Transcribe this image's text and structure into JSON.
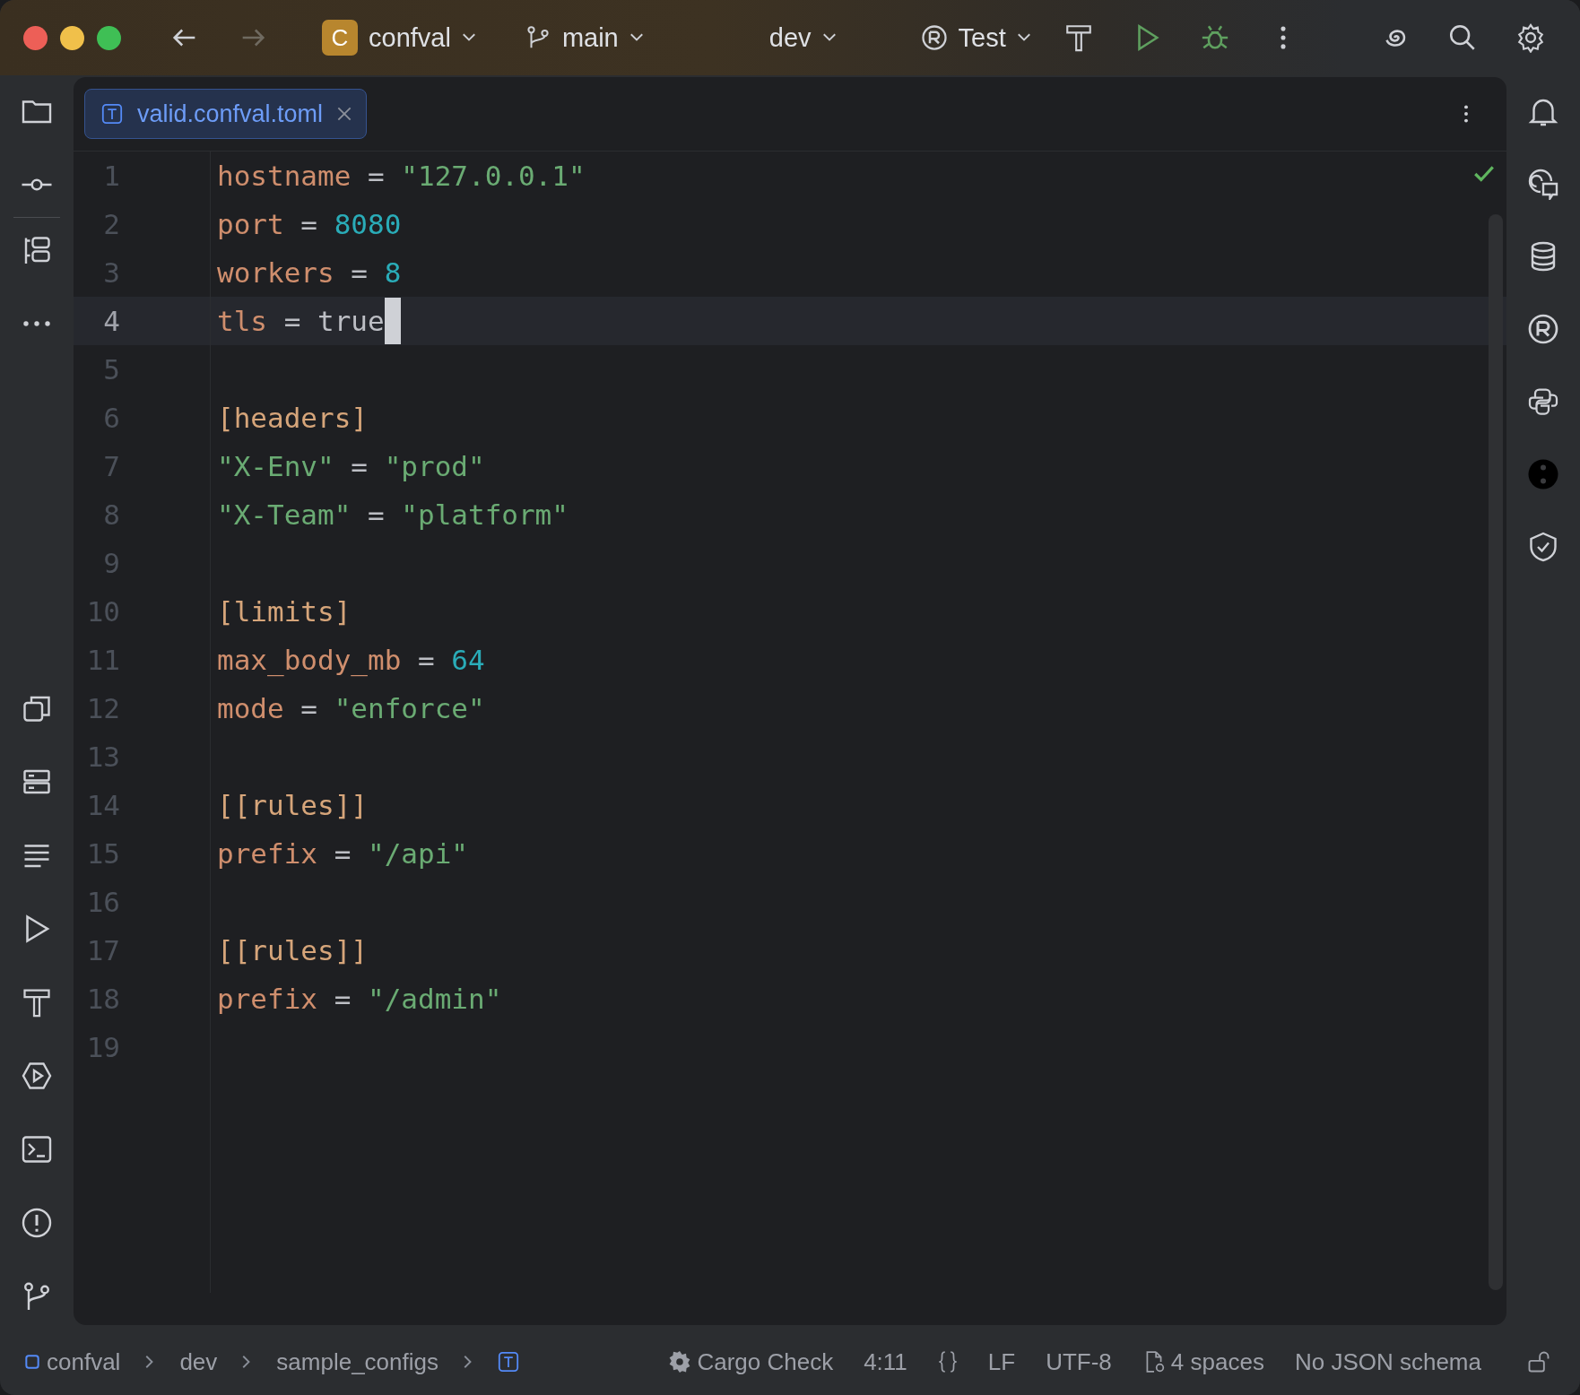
{
  "toolbar": {
    "project_badge": "C",
    "project": "confval",
    "branch": "main",
    "profile": "dev",
    "run_config": "Test"
  },
  "tabs": [
    {
      "label": "valid.confval.toml",
      "selected": true
    }
  ],
  "editor": {
    "lines": [
      {
        "number": "1",
        "current": false,
        "tokens": [
          {
            "kind": "key",
            "text": "hostname"
          },
          {
            "kind": "op",
            "text": " = "
          },
          {
            "kind": "string",
            "text": "\"127.0.0.1\""
          }
        ]
      },
      {
        "number": "2",
        "current": false,
        "tokens": [
          {
            "kind": "key",
            "text": "port"
          },
          {
            "kind": "op",
            "text": " = "
          },
          {
            "kind": "number",
            "text": "8080"
          }
        ]
      },
      {
        "number": "3",
        "current": false,
        "tokens": [
          {
            "kind": "key",
            "text": "workers"
          },
          {
            "kind": "op",
            "text": " = "
          },
          {
            "kind": "number",
            "text": "8"
          }
        ]
      },
      {
        "number": "4",
        "current": true,
        "tokens": [
          {
            "kind": "key",
            "text": "tls"
          },
          {
            "kind": "op",
            "text": " = "
          },
          {
            "kind": "bool",
            "text": "true"
          }
        ]
      },
      {
        "number": "5",
        "current": false
      },
      {
        "number": "6",
        "current": false,
        "tokens": [
          {
            "kind": "section",
            "text": "[headers]"
          }
        ]
      },
      {
        "number": "7",
        "current": false,
        "tokens": [
          {
            "kind": "string",
            "text": "\"X-Env\""
          },
          {
            "kind": "op",
            "text": " = "
          },
          {
            "kind": "string",
            "text": "\"prod\""
          }
        ]
      },
      {
        "number": "8",
        "current": false,
        "tokens": [
          {
            "kind": "string",
            "text": "\"X-Team\""
          },
          {
            "kind": "op",
            "text": " = "
          },
          {
            "kind": "string",
            "text": "\"platform\""
          }
        ]
      },
      {
        "number": "9",
        "current": false
      },
      {
        "number": "10",
        "current": false,
        "tokens": [
          {
            "kind": "section",
            "text": "[limits]"
          }
        ]
      },
      {
        "number": "11",
        "current": false,
        "tokens": [
          {
            "kind": "key",
            "text": "max_body_mb"
          },
          {
            "kind": "op",
            "text": " = "
          },
          {
            "kind": "number",
            "text": "64"
          }
        ]
      },
      {
        "number": "12",
        "current": false,
        "tokens": [
          {
            "kind": "key",
            "text": "mode"
          },
          {
            "kind": "op",
            "text": " = "
          },
          {
            "kind": "string",
            "text": "\"enforce\""
          }
        ]
      },
      {
        "number": "13",
        "current": false
      },
      {
        "number": "14",
        "current": false,
        "tokens": [
          {
            "kind": "section",
            "text": "[[rules]]"
          }
        ]
      },
      {
        "number": "15",
        "current": false,
        "tokens": [
          {
            "kind": "key",
            "text": "prefix"
          },
          {
            "kind": "op",
            "text": " = "
          },
          {
            "kind": "string",
            "text": "\"/api\""
          }
        ]
      },
      {
        "number": "16",
        "current": false
      },
      {
        "number": "17",
        "current": false,
        "tokens": [
          {
            "kind": "section",
            "text": "[[rules]]"
          }
        ]
      },
      {
        "number": "18",
        "current": false,
        "tokens": [
          {
            "kind": "key",
            "text": "prefix"
          },
          {
            "kind": "op",
            "text": " = "
          },
          {
            "kind": "string",
            "text": "\"/admin\""
          }
        ]
      },
      {
        "number": "19",
        "current": false
      }
    ]
  },
  "status_bar": {
    "breadcrumbs": [
      "confval",
      "dev",
      "sample_configs"
    ],
    "widget": "Cargo Check",
    "position": "4:11",
    "line_separator": "LF",
    "encoding": "UTF-8",
    "indent": "4 spaces",
    "schema": "No JSON schema"
  }
}
